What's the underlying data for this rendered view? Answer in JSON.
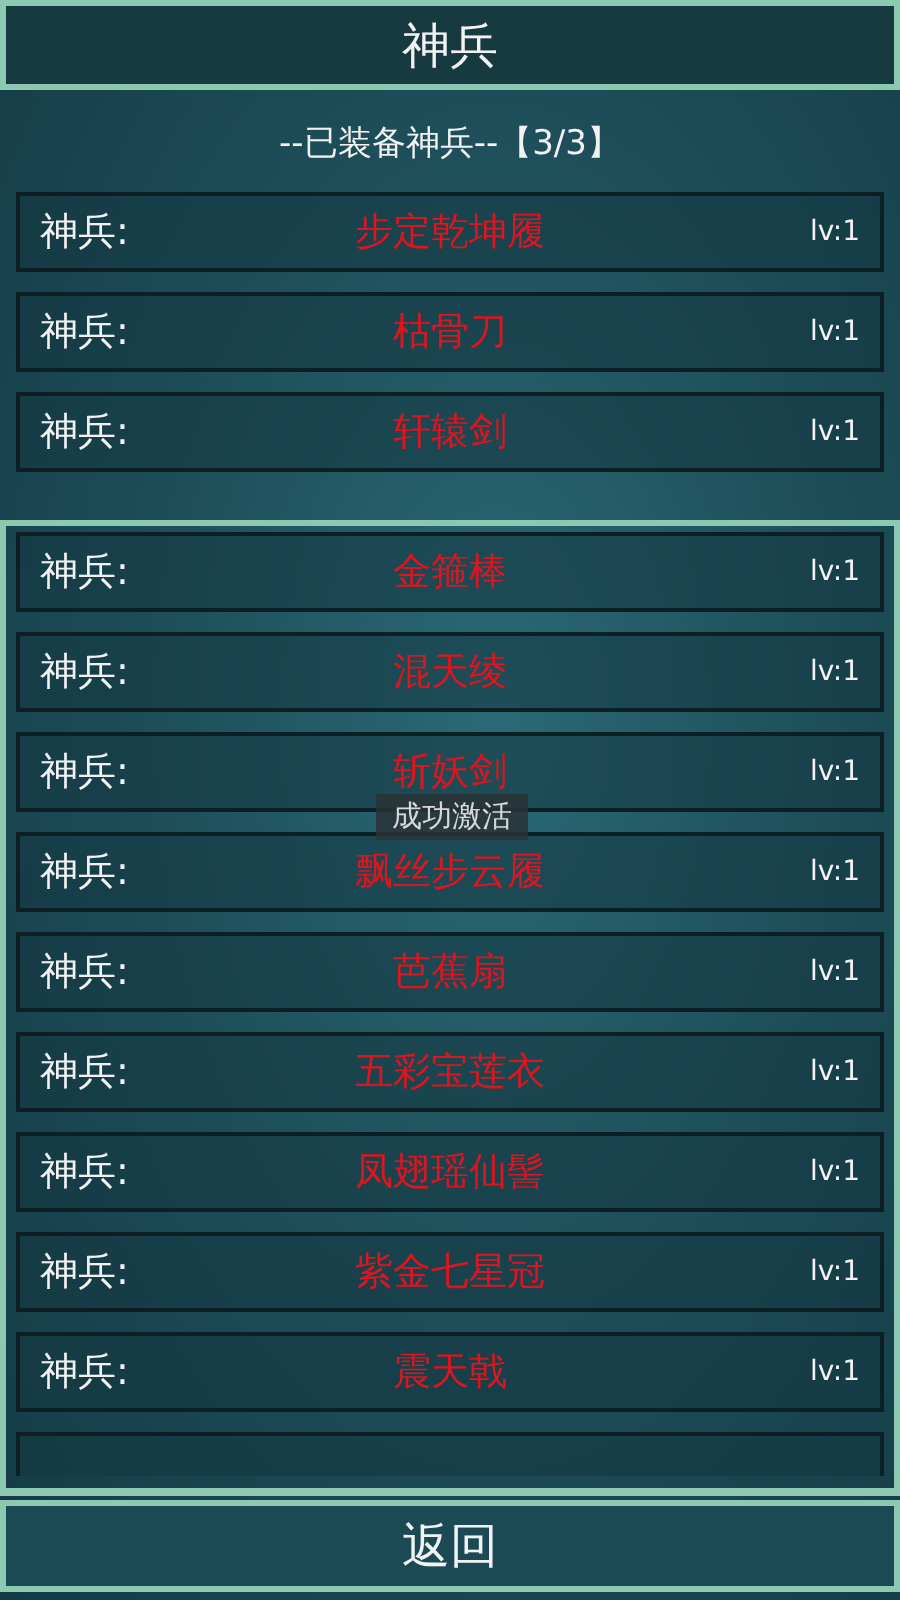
{
  "header": {
    "title": "神兵"
  },
  "equipped": {
    "heading": "--已装备神兵--【3/3】",
    "items": [
      {
        "label": "神兵:",
        "name": "步定乾坤履",
        "level": "lv:1"
      },
      {
        "label": "神兵:",
        "name": "枯骨刀",
        "level": "lv:1"
      },
      {
        "label": "神兵:",
        "name": "轩辕剑",
        "level": "lv:1"
      }
    ]
  },
  "collection": {
    "items": [
      {
        "label": "神兵:",
        "name": "金箍棒",
        "level": "lv:1"
      },
      {
        "label": "神兵:",
        "name": "混天绫",
        "level": "lv:1"
      },
      {
        "label": "神兵:",
        "name": "斩妖剑",
        "level": "lv:1"
      },
      {
        "label": "神兵:",
        "name": "飘丝步云履",
        "level": "lv:1"
      },
      {
        "label": "神兵:",
        "name": "芭蕉扇",
        "level": "lv:1"
      },
      {
        "label": "神兵:",
        "name": "五彩宝莲衣",
        "level": "lv:1"
      },
      {
        "label": "神兵:",
        "name": "凤翅瑶仙髻",
        "level": "lv:1"
      },
      {
        "label": "神兵:",
        "name": "紫金七星冠",
        "level": "lv:1"
      },
      {
        "label": "神兵:",
        "name": "震天戟",
        "level": "lv:1"
      }
    ]
  },
  "toast": "成功激活",
  "back_button": "返回"
}
